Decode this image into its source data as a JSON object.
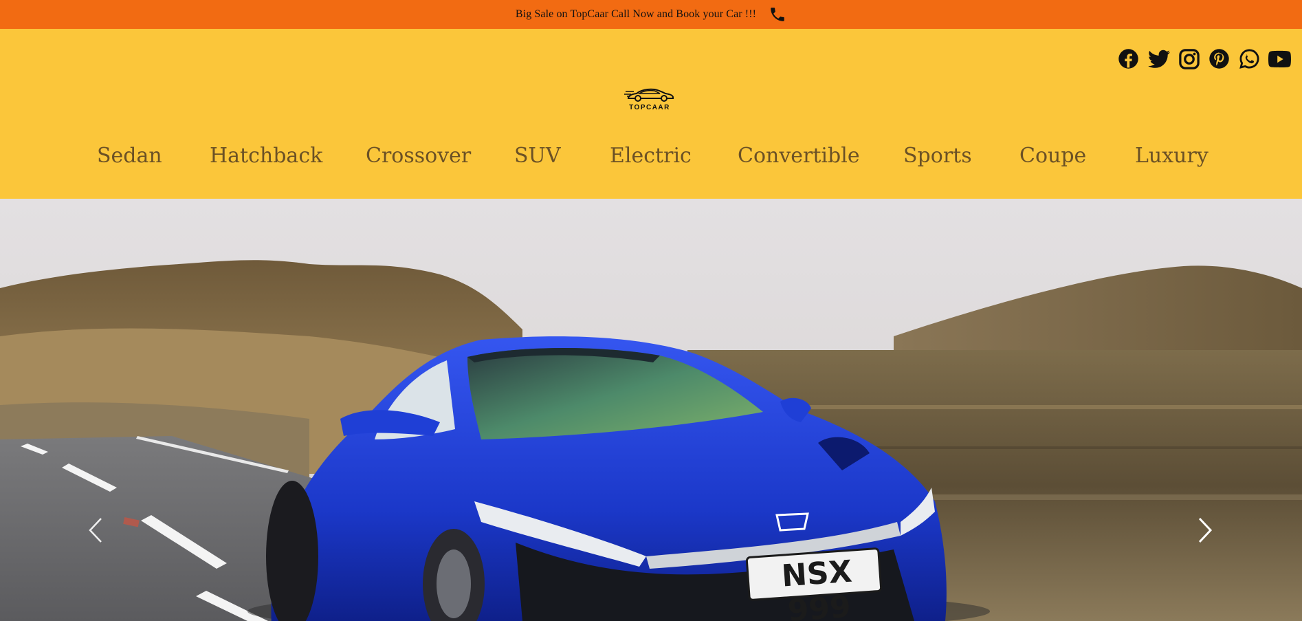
{
  "announcement": {
    "text": "Big Sale on TopCaar Call Now and Book your Car !!!",
    "icon": "phone-icon"
  },
  "colors": {
    "top_bar": "#f26b12",
    "header": "#fbc63a",
    "nav_text": "#6b5125",
    "car_body": "#1f3fd6"
  },
  "socials": [
    {
      "name": "facebook-icon"
    },
    {
      "name": "twitter-icon"
    },
    {
      "name": "instagram-icon"
    },
    {
      "name": "pinterest-icon"
    },
    {
      "name": "whatsapp-icon"
    },
    {
      "name": "youtube-icon"
    }
  ],
  "logo": {
    "text": "TOPCAAR"
  },
  "nav": {
    "items": [
      "Sedan",
      "Hatchback",
      "Crossover",
      "SUV",
      "Electric",
      "Convertible",
      "Sports",
      "Coupe",
      "Luxury"
    ]
  },
  "hero": {
    "plate": "NSX 999",
    "prev_icon": "chevron-left-icon",
    "next_icon": "chevron-right-icon"
  }
}
